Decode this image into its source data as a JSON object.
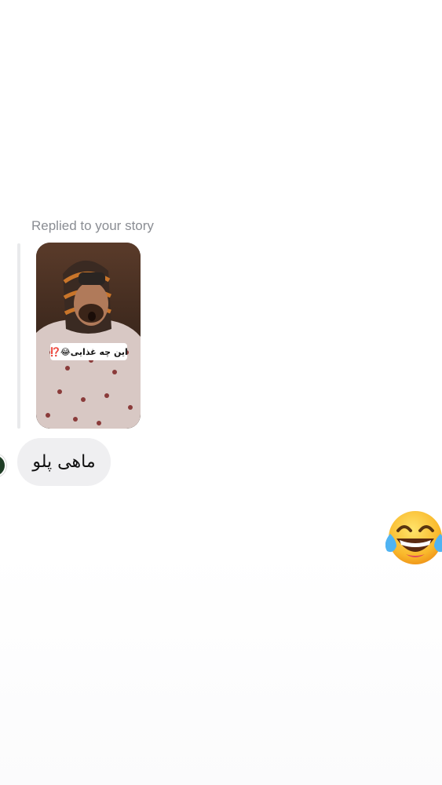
{
  "thread": {
    "reply_label": "Replied to your story",
    "story": {
      "caption": "این چه غذایی😂⁉️"
    },
    "incoming_message": "ماهی پلو",
    "outgoing_reaction": {
      "emoji": "😂",
      "icon": "face-with-tears-of-joy-icon"
    }
  }
}
